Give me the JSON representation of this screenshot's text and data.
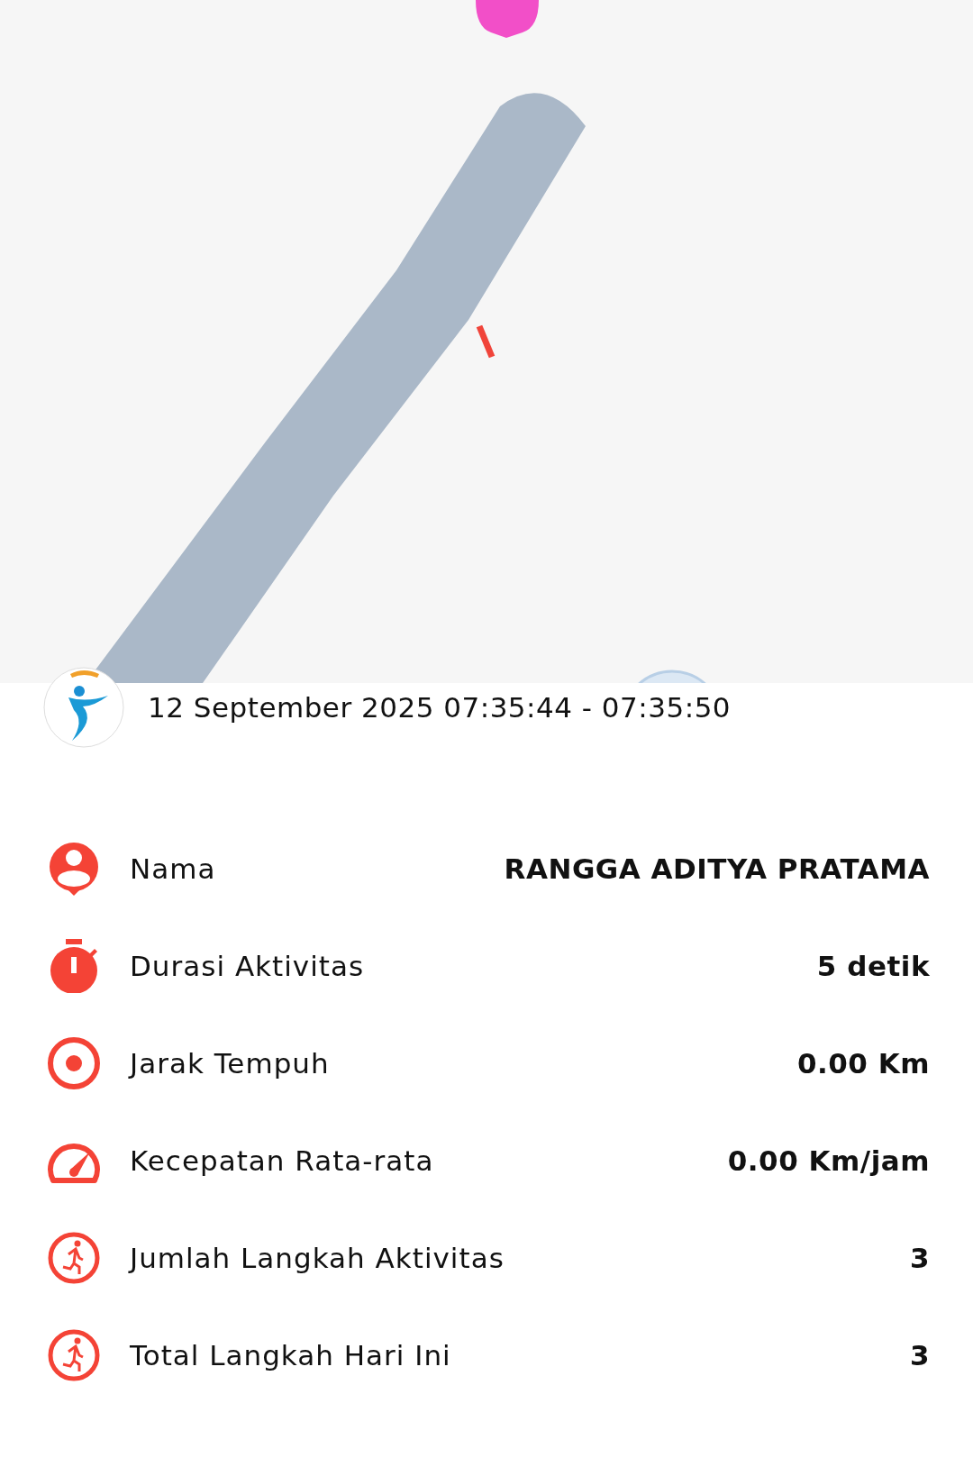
{
  "activity": {
    "time_range": "12 September 2025 07:35:44 - 07:35:50"
  },
  "stats": [
    {
      "kind": "person",
      "label": "Nama",
      "value": "RANGGA ADITYA PRATAMA"
    },
    {
      "kind": "timer",
      "label": "Durasi Aktivitas",
      "value": "5 detik"
    },
    {
      "kind": "target",
      "label": "Jarak Tempuh",
      "value": "0.00 Km"
    },
    {
      "kind": "speed",
      "label": "Kecepatan Rata-rata",
      "value": "0.00 Km/jam"
    },
    {
      "kind": "steps",
      "label": "Jumlah Langkah Aktivitas",
      "value": "3"
    },
    {
      "kind": "steps",
      "label": "Total Langkah Hari Ini",
      "value": "3"
    }
  ]
}
